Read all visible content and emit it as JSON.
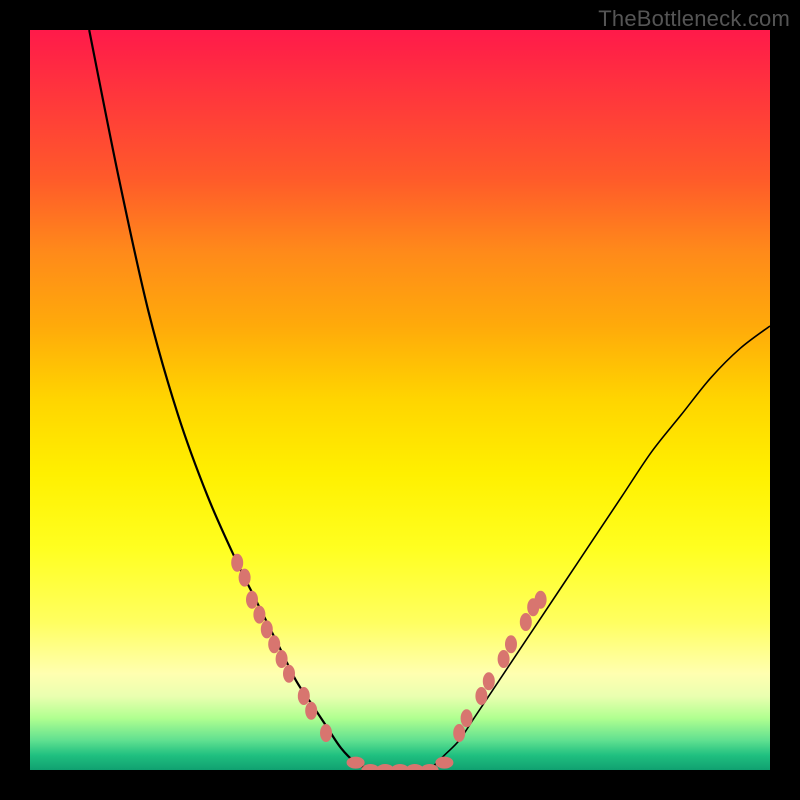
{
  "watermark": "TheBottleneck.com",
  "chart_data": {
    "type": "line",
    "title": "",
    "xlabel": "",
    "ylabel": "",
    "xlim": [
      0,
      100
    ],
    "ylim": [
      0,
      100
    ],
    "grid": false,
    "legend": false,
    "series": [
      {
        "name": "left-curve",
        "x": [
          8,
          12,
          16,
          20,
          24,
          28,
          30,
          32,
          34,
          36,
          38,
          40,
          42,
          44,
          46
        ],
        "values": [
          100,
          80,
          62,
          48,
          37,
          28,
          24,
          20,
          16,
          12,
          9,
          6,
          3,
          1,
          0
        ]
      },
      {
        "name": "right-curve",
        "x": [
          54,
          56,
          58,
          60,
          64,
          68,
          72,
          76,
          80,
          84,
          88,
          92,
          96,
          100
        ],
        "values": [
          0,
          2,
          4,
          7,
          13,
          19,
          25,
          31,
          37,
          43,
          48,
          53,
          57,
          60
        ]
      },
      {
        "name": "floor",
        "x": [
          46,
          48,
          50,
          52,
          54
        ],
        "values": [
          0,
          0,
          0,
          0,
          0
        ]
      }
    ],
    "markers_left": [
      {
        "x": 28,
        "y": 28
      },
      {
        "x": 29,
        "y": 26
      },
      {
        "x": 30,
        "y": 23
      },
      {
        "x": 31,
        "y": 21
      },
      {
        "x": 32,
        "y": 19
      },
      {
        "x": 33,
        "y": 17
      },
      {
        "x": 34,
        "y": 15
      },
      {
        "x": 35,
        "y": 13
      },
      {
        "x": 37,
        "y": 10
      },
      {
        "x": 38,
        "y": 8
      },
      {
        "x": 40,
        "y": 5
      }
    ],
    "markers_right": [
      {
        "x": 58,
        "y": 5
      },
      {
        "x": 59,
        "y": 7
      },
      {
        "x": 61,
        "y": 10
      },
      {
        "x": 62,
        "y": 12
      },
      {
        "x": 64,
        "y": 15
      },
      {
        "x": 65,
        "y": 17
      },
      {
        "x": 67,
        "y": 20
      },
      {
        "x": 68,
        "y": 22
      },
      {
        "x": 69,
        "y": 23
      }
    ],
    "markers_floor": [
      {
        "x": 44,
        "y": 1
      },
      {
        "x": 46,
        "y": 0
      },
      {
        "x": 48,
        "y": 0
      },
      {
        "x": 50,
        "y": 0
      },
      {
        "x": 52,
        "y": 0
      },
      {
        "x": 54,
        "y": 0
      },
      {
        "x": 56,
        "y": 1
      }
    ]
  },
  "colors": {
    "marker": "#d8756f",
    "curve": "#000000",
    "background_top": "#ff1a4a",
    "background_bottom": "#10a070"
  }
}
